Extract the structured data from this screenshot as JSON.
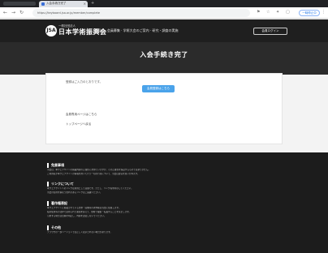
{
  "browser": {
    "tab_title": "入会手続き完了",
    "url": "https://keyboard.jsa.or.jp/member/complete",
    "profile_label": "一時停止中"
  },
  "site": {
    "logo_initial": "JSA",
    "logo_sub": "一般社団法人",
    "logo_main": "日本学術振興会",
    "nav": "ご案内 · 会員募集 · 学術大会のご案内 · 研究・調査の実施",
    "header_button": "会員ログイン"
  },
  "page": {
    "title": "入会手続き完了"
  },
  "content": {
    "notice": "登録はご入力のとおりです。",
    "button_label": "会員登録はこちら",
    "link_member_page": "会員専用ページはこちら",
    "link_top": "トップページへ戻る"
  },
  "footer": {
    "sections": [
      {
        "heading": "免責事項",
        "lines": [
          "当会は、本ウェブサイトの掲載内容の正確性に努めていますが、その正確性を保証するものではありません。",
          "ご利用者が本ウェブサイトの情報を用いて行う一切の行為について、当会は責任を負いかねます。"
        ]
      },
      {
        "heading": "リンクについて",
        "lines": [
          "本ウェブサイトへのリンクは原則として自由です。ただし、リンク先を明示してください。",
          "当会の信用を損なう恐れのあるリンクはご遠慮ください。"
        ]
      },
      {
        "heading": "著作権表記",
        "lines": [
          "本ウェブサイトに掲載されている文章・画像等の著作権は当会に帰属します。",
          "私的使用等の法律で認められた範囲を超えて、無断で複製・転載することを禁止します。",
          "引用する場合は出典を明記し、内容を改変しないでください。"
        ]
      },
      {
        "heading": "その他",
        "lines": [
          "ブラウザの一部バージョンでは正しく表示されない場合があります。"
        ]
      }
    ]
  },
  "colors": {
    "header_bg": "#1f1f1f",
    "banner_bg": "#2b2b2b",
    "button_accent": "#4aa3ea",
    "footer_bg": "#1c1c1c"
  }
}
